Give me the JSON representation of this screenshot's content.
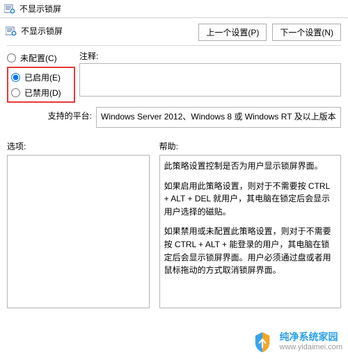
{
  "window": {
    "title": "不显示锁屏"
  },
  "sub": {
    "title": "不显示锁屏"
  },
  "nav": {
    "prev_label": "上一个设置(P)",
    "next_label": "下一个设置(N)"
  },
  "radios": {
    "not_configured": "未配置(C)",
    "enabled": "已启用(E)",
    "disabled": "已禁用(D)",
    "selected": "enabled"
  },
  "comment": {
    "label": "注释:"
  },
  "platform": {
    "label": "支持的平台:",
    "value": "Windows Server 2012、Windows 8 或 Windows RT 及以上版本"
  },
  "options": {
    "label": "选项:"
  },
  "help": {
    "label": "帮助:",
    "p1": "此策略设置控制是否为用户显示锁屏界面。",
    "p2": "如果启用此策略设置，则对于不需要按 CTRL + ALT + DEL  就用户，其电脑在锁定后会显示用户选择的磁贴。",
    "p3": "如果禁用或未配置此策略设置，则对于不需要按 CTRL + ALT + 能登录的用户，其电脑在锁定后会显示锁屏界面。用户必须通过盘或者用鼠标拖动的方式取消锁屏界面。"
  },
  "watermark": {
    "brand": "纯净系统家园",
    "url": "www.yidaimei.com"
  }
}
